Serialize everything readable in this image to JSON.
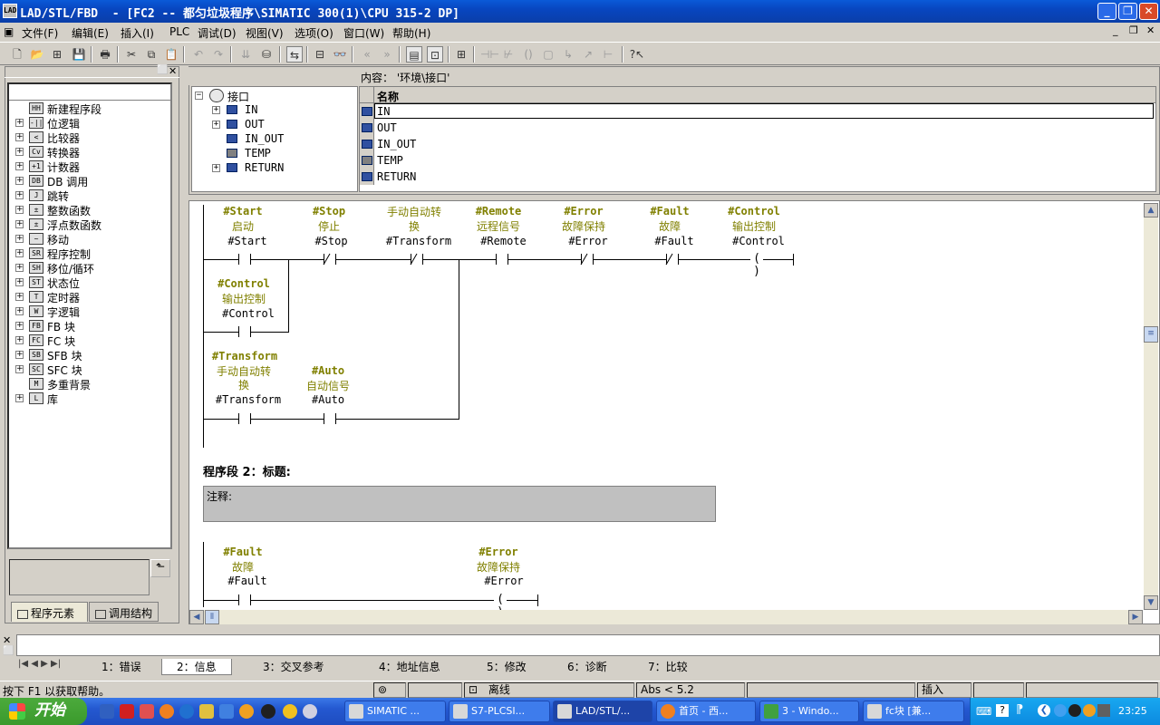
{
  "window": {
    "title": "LAD/STL/FBD  - [FC2 -- 都匀垃圾程序\\SIMATIC 300(1)\\CPU 315-2 DP]",
    "app_icon": "ladder-app-icon"
  },
  "menu": {
    "items": [
      "文件(F)",
      "编辑(E)",
      "插入(I)",
      "PLC",
      "调试(D)",
      "视图(V)",
      "选项(O)",
      "窗口(W)",
      "帮助(H)"
    ]
  },
  "left_panel": {
    "items": [
      {
        "label": "新建程序段",
        "icon": "HH",
        "expandable": false
      },
      {
        "label": "位逻辑",
        "icon": "-||",
        "expandable": true
      },
      {
        "label": "比较器",
        "icon": "<",
        "expandable": true
      },
      {
        "label": "转换器",
        "icon": "Cv",
        "expandable": true
      },
      {
        "label": "计数器",
        "icon": "+1",
        "expandable": true
      },
      {
        "label": "DB 调用",
        "icon": "DB",
        "expandable": true
      },
      {
        "label": "跳转",
        "icon": "J",
        "expandable": true
      },
      {
        "label": "整数函数",
        "icon": "±",
        "expandable": true
      },
      {
        "label": "浮点数函数",
        "icon": "±",
        "expandable": true
      },
      {
        "label": "移动",
        "icon": "~",
        "expandable": true
      },
      {
        "label": "程序控制",
        "icon": "SR",
        "expandable": true
      },
      {
        "label": "移位/循环",
        "icon": "SH",
        "expandable": true
      },
      {
        "label": "状态位",
        "icon": "ST",
        "expandable": true
      },
      {
        "label": "定时器",
        "icon": "T",
        "expandable": true
      },
      {
        "label": "字逻辑",
        "icon": "W",
        "expandable": true
      },
      {
        "label": "FB 块",
        "icon": "FB",
        "expandable": true
      },
      {
        "label": "FC 块",
        "icon": "FC",
        "expandable": true
      },
      {
        "label": "SFB 块",
        "icon": "SB",
        "expandable": true
      },
      {
        "label": "SFC 块",
        "icon": "SC",
        "expandable": true
      },
      {
        "label": "多重背景",
        "icon": "M",
        "expandable": false
      },
      {
        "label": "库",
        "icon": "L",
        "expandable": true
      }
    ],
    "tabs": [
      "程序元素",
      "调用结构"
    ]
  },
  "interface": {
    "content_label": "内容： '环境\\接口'",
    "root": "接口",
    "tree": [
      "IN",
      "OUT",
      "IN_OUT",
      "TEMP",
      "RETURN"
    ],
    "table_header": "名称",
    "rows": [
      "IN",
      "OUT",
      "IN_OUT",
      "TEMP",
      "RETURN"
    ]
  },
  "network1": {
    "contacts": [
      {
        "sym": "#Start",
        "comment": "启动",
        "addr": "#Start"
      },
      {
        "sym": "#Stop",
        "comment": "停止",
        "addr": "#Stop"
      },
      {
        "sym": "",
        "comment": "手动自动转换",
        "addr": "#Transform"
      },
      {
        "sym": "#Remote",
        "comment": "远程信号",
        "addr": "#Remote"
      },
      {
        "sym": "#Error",
        "comment": "故障保持",
        "addr": "#Error"
      },
      {
        "sym": "#Fault",
        "comment": "故障",
        "addr": "#Fault"
      },
      {
        "sym": "#Control",
        "comment": "输出控制",
        "addr": "#Control"
      }
    ],
    "branch1": {
      "sym": "#Control",
      "comment": "输出控制",
      "addr": "#Control"
    },
    "branch2a": {
      "sym": "#Transform",
      "comment1": "手动自动转",
      "comment2": "换",
      "addr": "#Transform"
    },
    "branch2b": {
      "sym": "#Auto",
      "comment": "自动信号",
      "addr": "#Auto"
    },
    "transform_comment_line1": "手动自动转",
    "transform_comment_line2": "换"
  },
  "network2": {
    "title": "程序段 2：标题:",
    "comment": "注释:",
    "contact": {
      "sym": "#Fault",
      "comment": "故障",
      "addr": "#Fault"
    },
    "coil": {
      "sym": "#Error",
      "comment": "故障保持",
      "addr": "#Error"
    }
  },
  "details": {
    "tabs": [
      "1：错误",
      "2：信息",
      "3：交叉参考",
      "4：地址信息",
      "5：修改",
      "6：诊断",
      "7：比较"
    ]
  },
  "status": {
    "help": "按下 F1 以获取帮助。",
    "mode": "离线",
    "abs": "Abs < 5.2",
    "insert": "插入"
  },
  "taskbar": {
    "start": "开始",
    "items": [
      "SIMATIC ...",
      "S7-PLCSI...",
      "LAD/STL/...",
      "首页 - 西...",
      "3 - Windo...",
      "fc块 [兼..."
    ],
    "clock": "23:25"
  }
}
